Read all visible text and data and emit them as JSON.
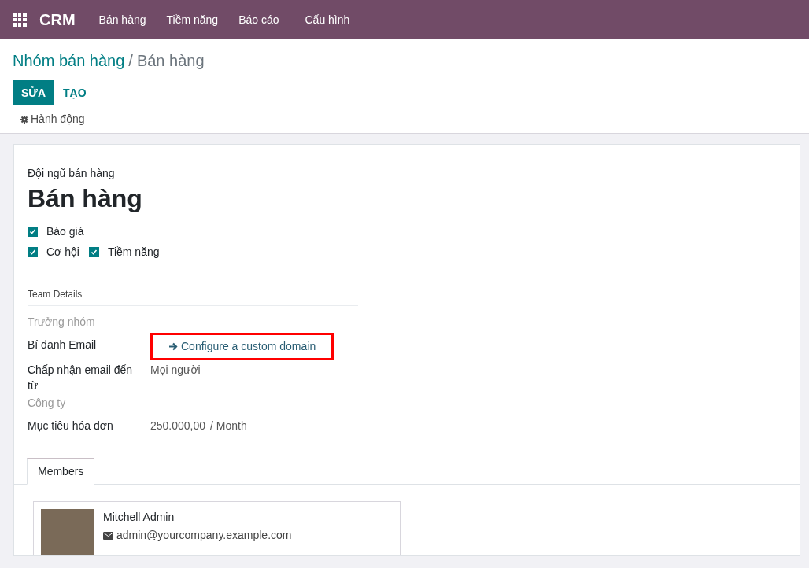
{
  "navbar": {
    "app_name": "CRM",
    "menu": [
      "Bán hàng",
      "Tiềm năng",
      "Báo cáo",
      "Cấu hình"
    ]
  },
  "breadcrumb": {
    "parent": "Nhóm bán hàng",
    "separator": "/",
    "current": "Bán hàng"
  },
  "buttons": [
    {
      "label": "SỬA",
      "kind": "primary"
    },
    {
      "label": "TẠO",
      "kind": "secondary"
    }
  ],
  "action_menu": "Hành động",
  "form": {
    "subtitle": "Đội ngũ bán hàng",
    "title": "Bán hàng",
    "checkbox_rows": [
      [
        {
          "label": "Báo giá",
          "checked": true
        }
      ],
      [
        {
          "label": "Cơ hội",
          "checked": true
        },
        {
          "label": "Tiềm năng",
          "checked": true
        }
      ]
    ],
    "section_title": "Team Details",
    "fields": [
      {
        "label": "Trưởng nhóm",
        "kind": "empty"
      },
      {
        "label": "Bí danh Email",
        "kind": "link",
        "value": "Configure a custom domain",
        "highlighted": true
      },
      {
        "label": "Chấp nhận email đến từ",
        "kind": "text",
        "value": "Mọi người"
      },
      {
        "label": "Công ty",
        "kind": "empty"
      },
      {
        "label": "Mục tiêu hóa đơn",
        "kind": "amount",
        "value": "250.000,00",
        "unit": "/ Month"
      }
    ],
    "tabs": [
      {
        "label": "Members",
        "selected": true
      }
    ],
    "members": [
      {
        "name": "Mitchell Admin",
        "email": "admin@yourcompany.example.com"
      }
    ]
  }
}
